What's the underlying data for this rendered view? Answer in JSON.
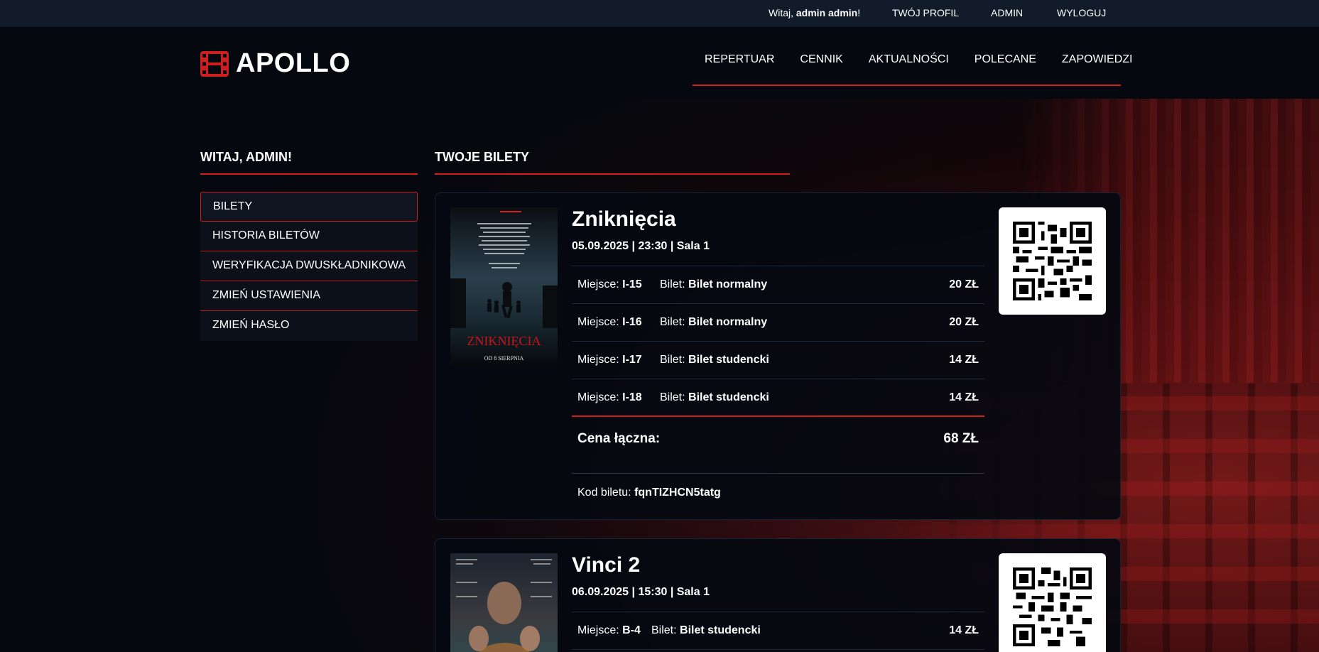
{
  "topbar": {
    "greeting_prefix": "Witaj, ",
    "user_name": "admin admin",
    "greeting_suffix": "!",
    "links": [
      "TWÓJ PROFIL",
      "ADMIN",
      "WYLOGUJ"
    ]
  },
  "brand": {
    "name": "APOLLO",
    "accent": "#d11f1f"
  },
  "nav": [
    "REPERTUAR",
    "CENNIK",
    "AKTUALNOŚCI",
    "POLECANE",
    "ZAPOWIEDZI"
  ],
  "sidebar": {
    "title": "WITAJ, ADMIN!",
    "items": [
      {
        "label": "BILETY",
        "active": true
      },
      {
        "label": "HISTORIA BILETÓW"
      },
      {
        "label": "WERYFIKACJA DWUSKŁADNIKOWA"
      },
      {
        "label": "ZMIEŃ USTAWIENIA"
      },
      {
        "label": "ZMIEŃ HASŁO"
      }
    ]
  },
  "main": {
    "title": "TWOJE BILETY",
    "tickets": [
      {
        "movie": "Zniknięcia",
        "meta": "05.09.2025 | 23:30 | Sala 1",
        "poster_title": "ZNIKNIĘCIA",
        "poster_sub": "OD 8 SIERPNIA",
        "seats": [
          {
            "seat_label": "Miejsce: ",
            "seat": "I-15",
            "type_label": "Bilet: ",
            "type": "Bilet normalny",
            "price": "20 ZŁ"
          },
          {
            "seat_label": "Miejsce: ",
            "seat": "I-16",
            "type_label": "Bilet: ",
            "type": "Bilet normalny",
            "price": "20 ZŁ"
          },
          {
            "seat_label": "Miejsce: ",
            "seat": "I-17",
            "type_label": "Bilet: ",
            "type": "Bilet studencki",
            "price": "14 ZŁ"
          },
          {
            "seat_label": "Miejsce: ",
            "seat": "I-18",
            "type_label": "Bilet: ",
            "type": "Bilet studencki",
            "price": "14 ZŁ"
          }
        ],
        "total_label": "Cena łączna:",
        "total": "68 ZŁ",
        "code_label": "Kod biletu: ",
        "code": "fqnTIZHCN5tatg"
      },
      {
        "movie": "Vinci 2",
        "meta": "06.09.2025 | 15:30 | Sala 1",
        "seats": [
          {
            "seat_label": "Miejsce: ",
            "seat": "B-4",
            "type_label": "Bilet: ",
            "type": "Bilet studencki",
            "price": "14 ZŁ"
          }
        ]
      }
    ]
  }
}
